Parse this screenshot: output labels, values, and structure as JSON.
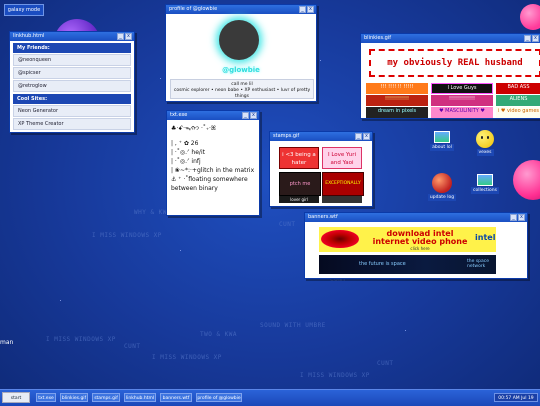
{
  "desktop": {
    "galaxy_tab": "galaxy mode",
    "bg_texts": [
      "I MISS WINDOWS XP",
      "CUNT",
      "I MISS WINDOWS XP",
      "TWO & KWA",
      "I MISS WINDOWS XP",
      "I MISS WINDOWS XP",
      "CUNT",
      "CUNT",
      "SOUND WITH UMBRE",
      "CUNT",
      "WHY & KWA"
    ],
    "left_edge_text": "man"
  },
  "linkhub": {
    "title": "linkhub.html",
    "friends_heading": "My Friends:",
    "friends": [
      "@neonqueen",
      "@spicser",
      "@retroglow"
    ],
    "sites_heading": "Cool Sites:",
    "sites": [
      "Neon Generator",
      "XP Theme Creator"
    ]
  },
  "profile": {
    "title": "profile of @glowbie",
    "username": "@glowbie",
    "call_me": "call me lil",
    "bio": "cosmic explorer • neon babe • XP enthusiast • luvr of pretty things"
  },
  "blinkies": {
    "title": "blinkies.gif",
    "banner_text": "my obviously REAL husband",
    "items": [
      "!!! !!!! !! !!!!!",
      "I Love Guys",
      "BAD ASS",
      "!!!!!!!!!!!!",
      "!!!!!!!!!!!!!",
      "ALIENS",
      "dream in pixels",
      "♥ MASCULINITY ♥",
      "i ♥ video games"
    ]
  },
  "txt": {
    "title": "txt.exe",
    "lines": [
      "♣·ꗃ·ᯓᡣ𐭩 ·˚₊‧ꕤ",
      "| , ⁺ ✿ 26",
      "| ·˚◎.ᐟ he/it",
      "| ·˚◎.ᐟ infj",
      "| ❀~*:·+glitch in the matrix",
      "⚓ ⁺ ·˚floating somewhere between binary"
    ]
  },
  "stamps": {
    "title": "stamps.gif",
    "items": [
      "i <3 being a hater",
      "I Love Yuri and Yaoi",
      "ptch me",
      "EXCEPTIONALLY",
      "lover girl",
      ""
    ]
  },
  "icons": [
    {
      "name": "about lol",
      "icon": "picture-icon"
    },
    {
      "name": "vexes",
      "icon": "smiley-icon"
    },
    {
      "name": "update log",
      "icon": "planet-icon"
    },
    {
      "name": "collections",
      "icon": "picture-icon"
    }
  ],
  "banners": {
    "title": "banners.wtf",
    "ad1_line1": "download intel",
    "ad1_line2": "internet video phone",
    "ad1_click": "click here",
    "ad1_brand": "intel",
    "ad2_left": "the future is space",
    "ad2_right": "the space network"
  },
  "taskbar": {
    "start": "start",
    "items": [
      "txt.exe",
      "blinkies.gif",
      "stamps.gif",
      "linkhub.html",
      "banners.wtf",
      "profile of @glowbie"
    ],
    "clock": "00:57 AM Jul 19"
  },
  "colors": {
    "accent": "#1a4fc2",
    "desktop": "#17399a",
    "planet_purple": "#6a2fd0",
    "planet_pink": "#ff4aa0"
  }
}
